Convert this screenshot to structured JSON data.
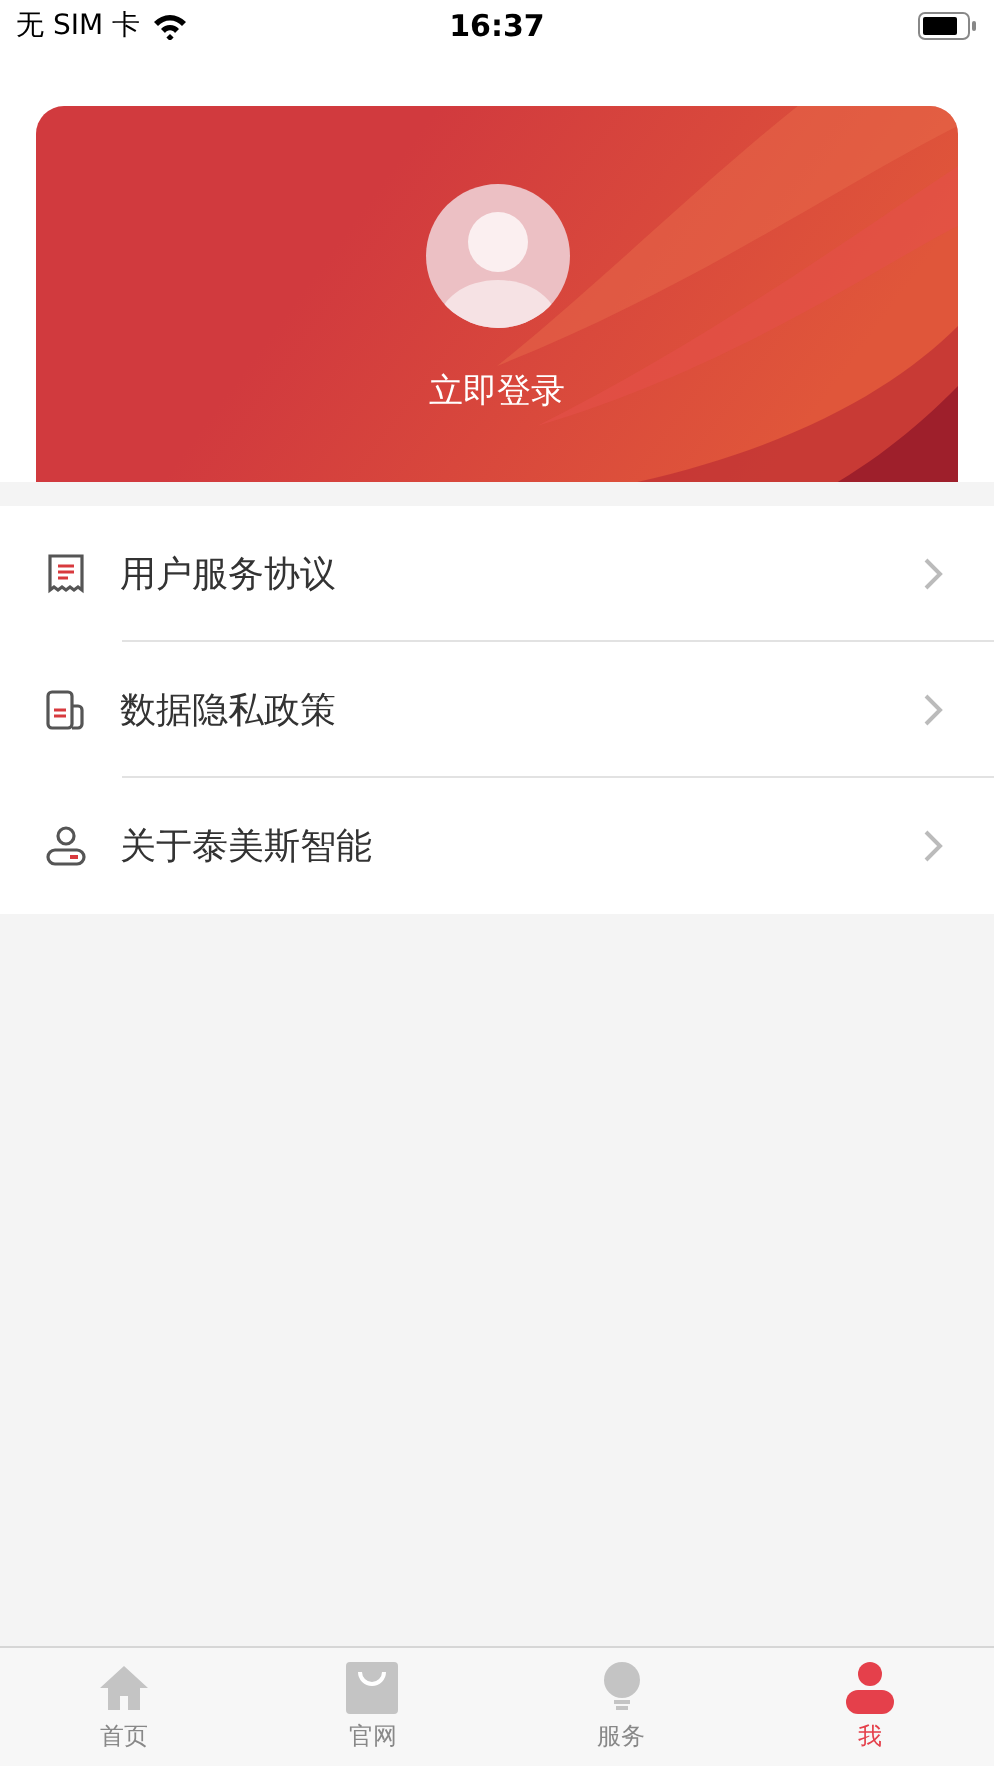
{
  "status_bar": {
    "carrier": "无 SIM 卡",
    "time": "16:37"
  },
  "profile_card": {
    "login_label": "立即登录"
  },
  "menu": [
    {
      "kind": "agreement",
      "label": "用户服务协议"
    },
    {
      "kind": "privacy",
      "label": "数据隐私政策"
    },
    {
      "kind": "about",
      "label": "关于泰美斯智能"
    }
  ],
  "tabs": [
    {
      "kind": "home",
      "label": "首页",
      "selected": false
    },
    {
      "kind": "shop",
      "label": "官网",
      "selected": false
    },
    {
      "kind": "service",
      "label": "服务",
      "selected": false
    },
    {
      "kind": "me",
      "label": "我",
      "selected": true
    }
  ]
}
